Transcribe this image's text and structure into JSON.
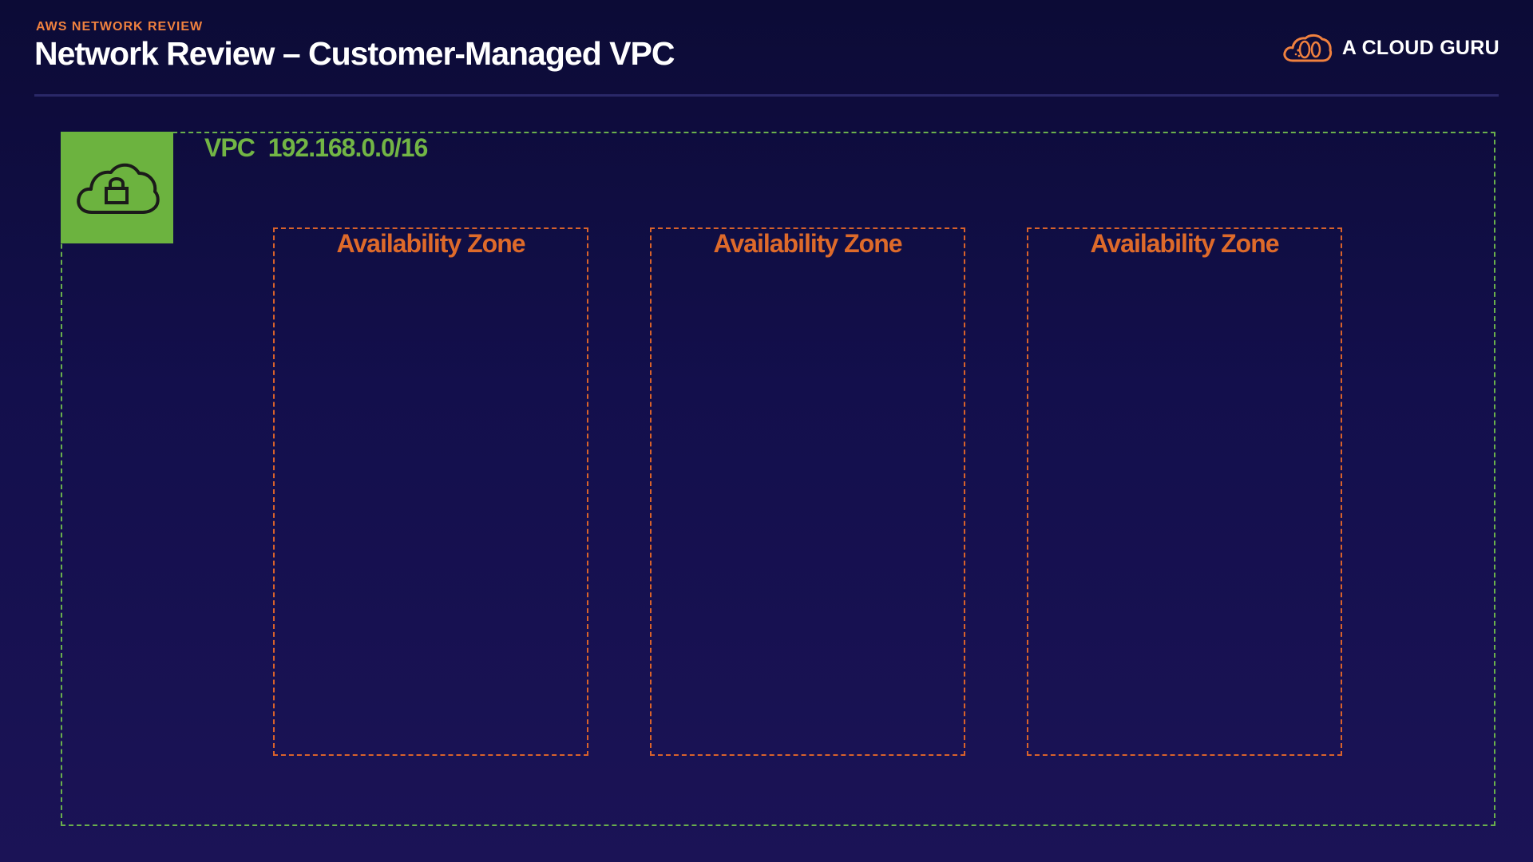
{
  "header": {
    "eyebrow": "AWS NETWORK REVIEW",
    "title": "Network Review – Customer-Managed VPC"
  },
  "brand": {
    "name": "A CLOUD GURU",
    "logo_icon": "cloud-logo-icon"
  },
  "vpc": {
    "label": "VPC",
    "cidr": "192.168.0.0/16",
    "icon": "cloud-lock-icon"
  },
  "availability_zones": [
    {
      "label": "Availability Zone"
    },
    {
      "label": "Availability Zone"
    },
    {
      "label": "Availability Zone"
    }
  ],
  "colors": {
    "background": "#130f4c",
    "accent_orange": "#f0813f",
    "vpc_green": "#6cb33f",
    "az_orange": "#d9622b",
    "text_white": "#ffffff"
  }
}
